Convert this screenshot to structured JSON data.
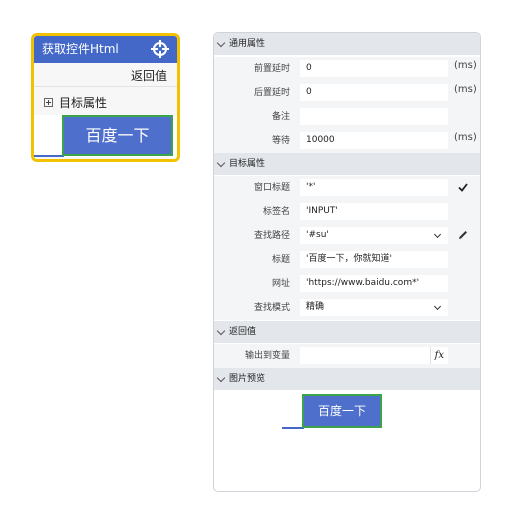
{
  "card": {
    "title": "获取控件Html",
    "return_label": "返回值",
    "target_attr_label": "目标属性",
    "preview_button_text": "百度一下"
  },
  "panel": {
    "sections": {
      "general": "通用属性",
      "target": "目标属性",
      "return": "返回值",
      "preview": "图片预览"
    },
    "general": {
      "pre_delay": {
        "label": "前置延时",
        "value": "0",
        "unit": "(ms)"
      },
      "post_delay": {
        "label": "后置延时",
        "value": "0",
        "unit": "(ms)"
      },
      "note": {
        "label": "备注",
        "value": ""
      },
      "wait": {
        "label": "等待",
        "value": "10000",
        "unit": "(ms)"
      }
    },
    "target": {
      "window_title": {
        "label": "窗口标题",
        "value": "'*'"
      },
      "tag_name": {
        "label": "标签名",
        "value": "'INPUT'"
      },
      "find_path": {
        "label": "查找路径",
        "value": "'#su'"
      },
      "title": {
        "label": "标题",
        "value": "'百度一下，你就知道'"
      },
      "url": {
        "label": "网址",
        "value": "'https://www.baidu.com*'"
      },
      "find_mode": {
        "label": "查找模式",
        "value": "精确"
      }
    },
    "return": {
      "output_var": {
        "label": "输出到变量",
        "value": "",
        "fx": "fx"
      }
    },
    "preview": {
      "button_text": "百度一下"
    }
  },
  "colors": {
    "accent": "#4468c8",
    "highlight_border": "#f2c200",
    "button_blue": "#4e6fcc",
    "green_border": "#3ba34a"
  }
}
